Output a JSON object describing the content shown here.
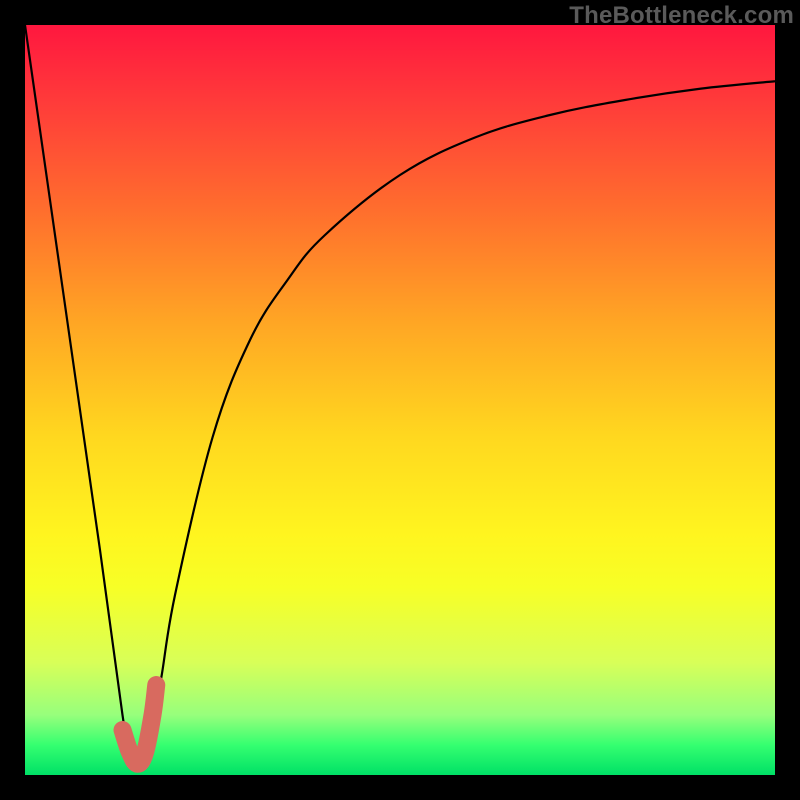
{
  "watermark": "TheBottleneck.com",
  "chart_data": {
    "type": "line",
    "title": "",
    "xlabel": "",
    "ylabel": "",
    "xlim": [
      0,
      100
    ],
    "ylim": [
      0,
      100
    ],
    "series": [
      {
        "name": "bottleneck-curve",
        "x": [
          0,
          5,
          10,
          13,
          14,
          15,
          16,
          18,
          20,
          25,
          30,
          35,
          40,
          50,
          60,
          70,
          80,
          90,
          100
        ],
        "values": [
          100,
          65,
          30,
          8,
          3,
          1,
          3,
          12,
          24,
          45,
          58,
          66,
          72,
          80,
          85,
          88,
          90,
          91.5,
          92.5
        ]
      },
      {
        "name": "highlight-segment",
        "x": [
          13,
          14,
          15,
          16,
          17,
          17.5
        ],
        "values": [
          6,
          3,
          1.5,
          3,
          8,
          12
        ]
      }
    ],
    "colors": {
      "curve": "#000000",
      "highlight": "#d86a5f"
    }
  }
}
